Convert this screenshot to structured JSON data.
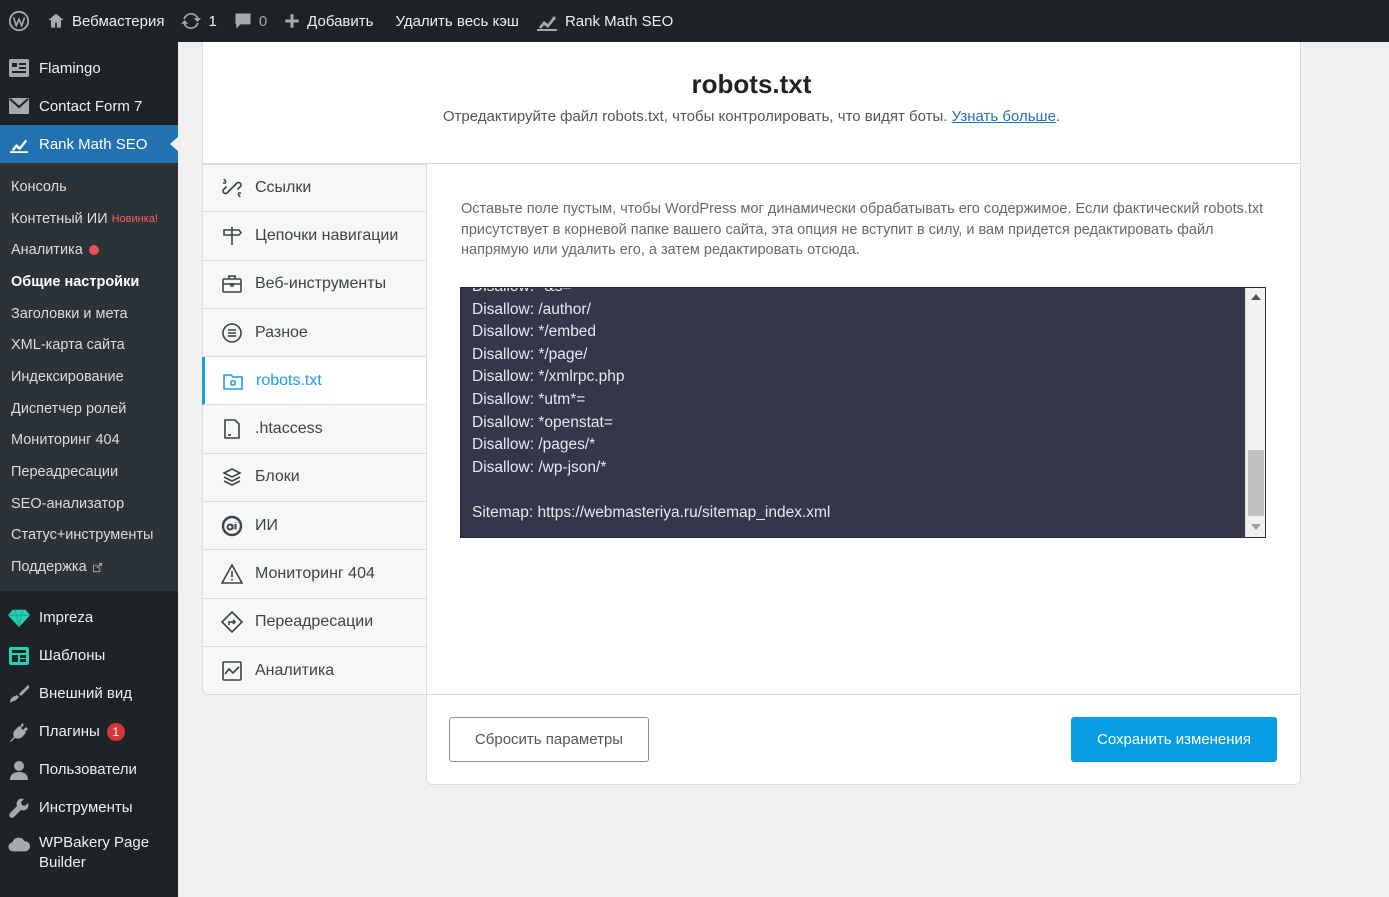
{
  "adminbar": {
    "site_name": "Вебмастерия",
    "updates_count": "1",
    "comments_count": "0",
    "add_new": "Добавить",
    "clear_cache": "Удалить весь кэш",
    "rank_math": "Rank Math SEO"
  },
  "sidebar": {
    "top_items": [
      {
        "label": "Flamingo",
        "icon": "flamingo-icon"
      },
      {
        "label": "Contact Form 7",
        "icon": "mail-icon"
      },
      {
        "label": "Rank Math SEO",
        "icon": "rank-math-icon"
      }
    ],
    "submenu": [
      {
        "label": "Консоль"
      },
      {
        "label": "Контетный ИИ",
        "badge": "Новинка!"
      },
      {
        "label": "Аналитика"
      },
      {
        "label": "Общие настройки"
      },
      {
        "label": "Заголовки и мета"
      },
      {
        "label": "XML-карта сайта"
      },
      {
        "label": "Индексирование"
      },
      {
        "label": "Диспетчер ролей"
      },
      {
        "label": "Мониторинг 404"
      },
      {
        "label": "Переадресации"
      },
      {
        "label": "SEO-анализатор"
      },
      {
        "label": "Статус+инструменты"
      },
      {
        "label": "Поддержка"
      }
    ],
    "bottom_items": [
      {
        "label": "Impreza",
        "icon": "diamond-icon"
      },
      {
        "label": "Шаблоны",
        "icon": "templates-icon"
      },
      {
        "label": "Внешний вид",
        "icon": "brush-icon"
      },
      {
        "label": "Плагины",
        "icon": "plugin-icon",
        "badge": "1"
      },
      {
        "label": "Пользователи",
        "icon": "user-icon"
      },
      {
        "label": "Инструменты",
        "icon": "wrench-icon"
      },
      {
        "label": "WPBakery Page Builder",
        "icon": "cloud-icon"
      }
    ]
  },
  "header": {
    "title": "robots.txt",
    "subtitle": "Отредактируйте файл robots.txt, чтобы контролировать, что видят боты.",
    "learn_more": "Узнать больше",
    "period": "."
  },
  "tabs": [
    {
      "label": "Ссылки",
      "icon": "links-icon"
    },
    {
      "label": "Цепочки навигации",
      "icon": "signpost-icon"
    },
    {
      "label": "Веб-инструменты",
      "icon": "toolbox-icon"
    },
    {
      "label": "Разное",
      "icon": "list-circle-icon"
    },
    {
      "label": "robots.txt",
      "icon": "folder-icon"
    },
    {
      "label": ".htaccess",
      "icon": "file-icon"
    },
    {
      "label": "Блоки",
      "icon": "blocks-icon"
    },
    {
      "label": "ИИ",
      "icon": "ai-icon"
    },
    {
      "label": "Мониторинг 404",
      "icon": "warning-icon"
    },
    {
      "label": "Переадресации",
      "icon": "redirect-icon"
    },
    {
      "label": "Аналитика",
      "icon": "analytics-icon"
    }
  ],
  "content": {
    "description": "Оставьте поле пустым, чтобы WordPress мог динамически обрабатывать его содержимое. Если фактический robots.txt присутствует в корневой папке вашего сайта, эта опция не вступит в силу, и вам придется редактировать файл напрямую или удалить его, а затем редактировать отсюда.",
    "editor_lines": [
      "Disallow: *&s=",
      "Disallow: /author/",
      "Disallow: */embed",
      "Disallow: */page/",
      "Disallow: */xmlrpc.php",
      "Disallow: *utm*=",
      "Disallow: *openstat=",
      "Disallow: /pages/*",
      "Disallow: /wp-json/*",
      "",
      "Sitemap: https://webmasteriya.ru/sitemap_index.xml"
    ]
  },
  "footer": {
    "reset_label": "Сбросить параметры",
    "save_label": "Сохранить изменения"
  }
}
